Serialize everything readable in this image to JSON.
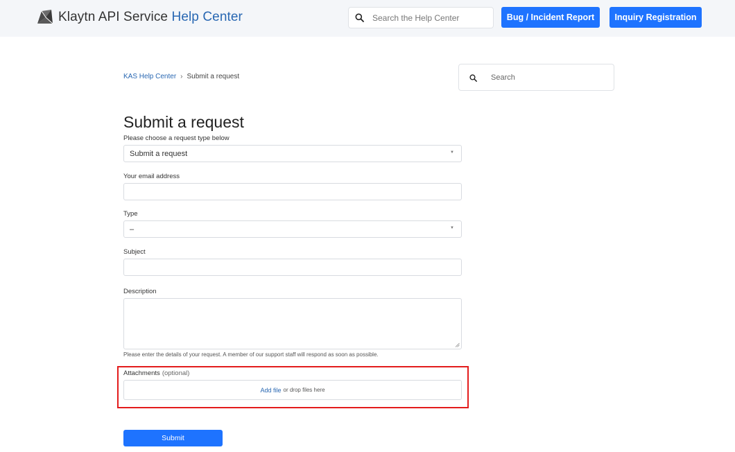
{
  "header": {
    "logo_brand": "Klaytn API Service",
    "logo_suffix": "Help Center",
    "search_placeholder": "Search the Help Center",
    "bug_button": "Bug / Incident Report",
    "inquiry_button": "Inquiry Registration"
  },
  "breadcrumb": {
    "home": "KAS Help Center",
    "separator": "›",
    "current": "Submit a request"
  },
  "side_search": {
    "placeholder": "Search"
  },
  "page_title": "Submit a request",
  "form": {
    "request_type": {
      "label": "Please choose a request type below",
      "value": "Submit a request"
    },
    "email": {
      "label": "Your email address",
      "value": ""
    },
    "type": {
      "label": "Type",
      "value": "–"
    },
    "subject": {
      "label": "Subject",
      "value": ""
    },
    "description": {
      "label": "Description",
      "value": "",
      "hint": "Please enter the details of your request. A member of our support staff will respond as soon as possible."
    },
    "attachments": {
      "label": "Attachments",
      "optional": "(optional)",
      "add_file": "Add file",
      "drop_text": "or drop files here"
    },
    "submit_label": "Submit"
  },
  "icons": {
    "logo": "klaytn-logo-icon",
    "search": "search-icon",
    "select_caret": "caret-down-icon",
    "resize": "resize-handle-icon"
  },
  "colors": {
    "primary": "#1e73ff",
    "link": "#2867b2",
    "header_bg": "#f4f6f9",
    "highlight": "#e31b1b"
  }
}
